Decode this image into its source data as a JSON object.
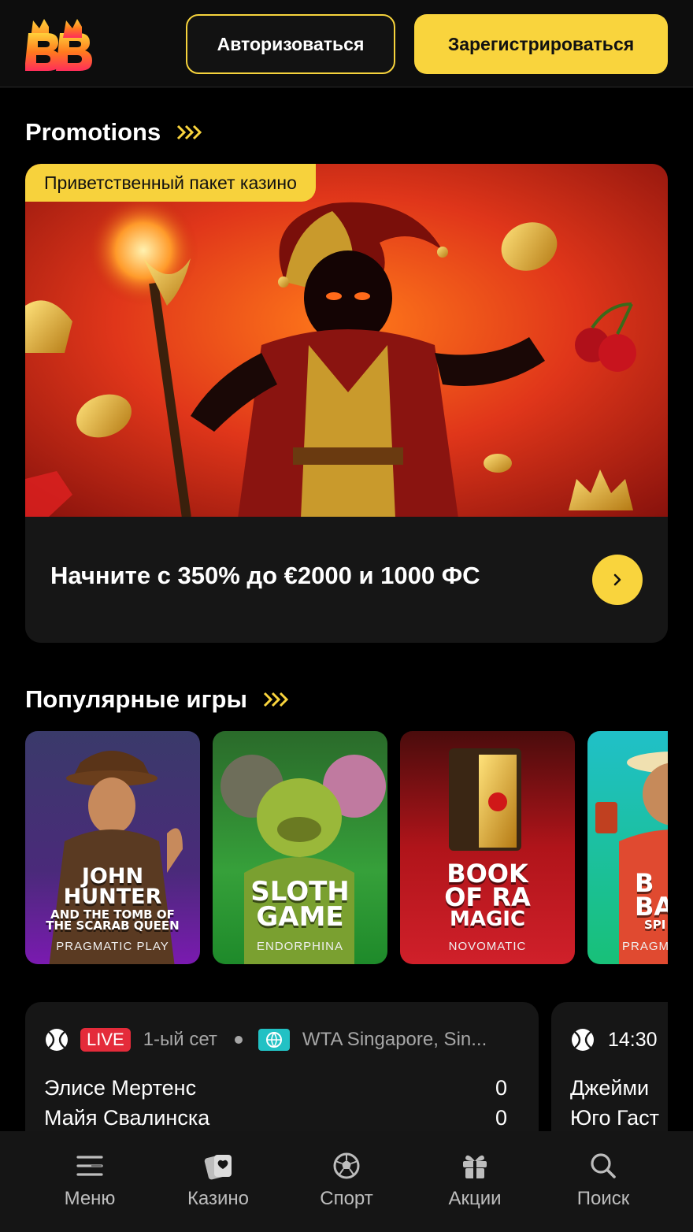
{
  "header": {
    "login_label": "Авторизоваться",
    "register_label": "Зарегистрироваться",
    "brand_color": "#f9d43d"
  },
  "promotions": {
    "title": "Promotions",
    "card": {
      "tag": "Приветственный пакет казино",
      "text": "Начните с 350% до €2000 и 1000 ФС"
    }
  },
  "popular": {
    "title": "Популярные игры",
    "games": [
      {
        "title_line1": "JOHN",
        "title_line2": "HUNTER",
        "subtitle": "AND THE TOMB OF THE SCARAB QUEEN",
        "provider": "PRAGMATIC PLAY"
      },
      {
        "title_line1": "SLOTH",
        "title_line2": "GAME",
        "provider": "ENDORPHINA"
      },
      {
        "title_line1": "BOOK",
        "title_line2": "OF RA",
        "title_line3": "MAGIC",
        "provider": "NOVOMATIC"
      },
      {
        "title_line1": "B",
        "title_line2": "BA",
        "subtitle": "SPI",
        "provider": "PRAGM"
      }
    ]
  },
  "matches": [
    {
      "status": "LIVE",
      "period": "1-ый сет",
      "tournament": "WTA Singapore, Sin...",
      "team1": "Элисе Мертенс",
      "team2": "Майя Свалинска",
      "score1": "0",
      "score2": "0"
    },
    {
      "time": "14:30",
      "team1": "Джейми",
      "team2": "Юго Гаст"
    }
  ],
  "bottom_nav": [
    {
      "label": "Меню",
      "icon": "menu-icon"
    },
    {
      "label": "Казино",
      "icon": "cards-icon"
    },
    {
      "label": "Спорт",
      "icon": "soccer-ball-icon"
    },
    {
      "label": "Акции",
      "icon": "gift-icon"
    },
    {
      "label": "Поиск",
      "icon": "search-icon"
    }
  ]
}
